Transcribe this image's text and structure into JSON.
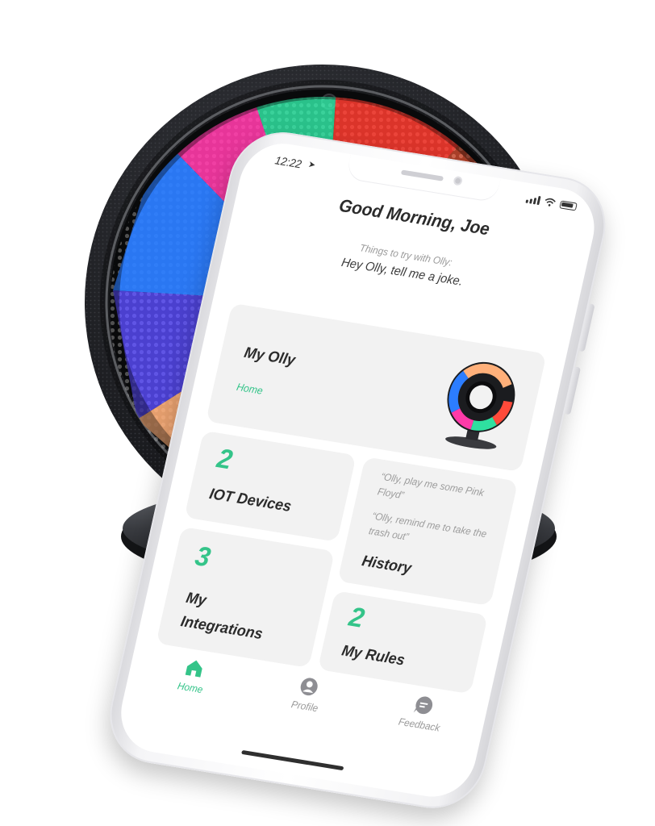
{
  "status_bar": {
    "time": "12:22"
  },
  "home": {
    "greeting": "Good Morning, Joe",
    "try_label": "Things to try with Olly:",
    "try_text": "Hey Olly, tell me a joke."
  },
  "cards": {
    "my_olly": {
      "title": "My Olly",
      "subtitle": "Home"
    },
    "iot_devices": {
      "count": "2",
      "label": "IOT Devices"
    },
    "history": {
      "quote_1": "“Olly, play me some Pink Floyd”",
      "quote_2": "“Olly, remind me to take the trash out”",
      "label": "History"
    },
    "my_integrations": {
      "count": "3",
      "label_line_1": "My",
      "label_line_2": "Integrations"
    },
    "my_rules": {
      "count": "2",
      "label": "My Rules"
    }
  },
  "tabs": [
    {
      "label": "Home",
      "icon": "home-icon",
      "active": true
    },
    {
      "label": "Profile",
      "icon": "profile-icon",
      "active": false
    },
    {
      "label": "Feedback",
      "icon": "feedback-icon",
      "active": false
    }
  ],
  "colors": {
    "accent": "#34c489",
    "card_background": "#f2f2f2",
    "text_primary": "#2b2b2b",
    "text_muted": "#9a9a9a"
  }
}
